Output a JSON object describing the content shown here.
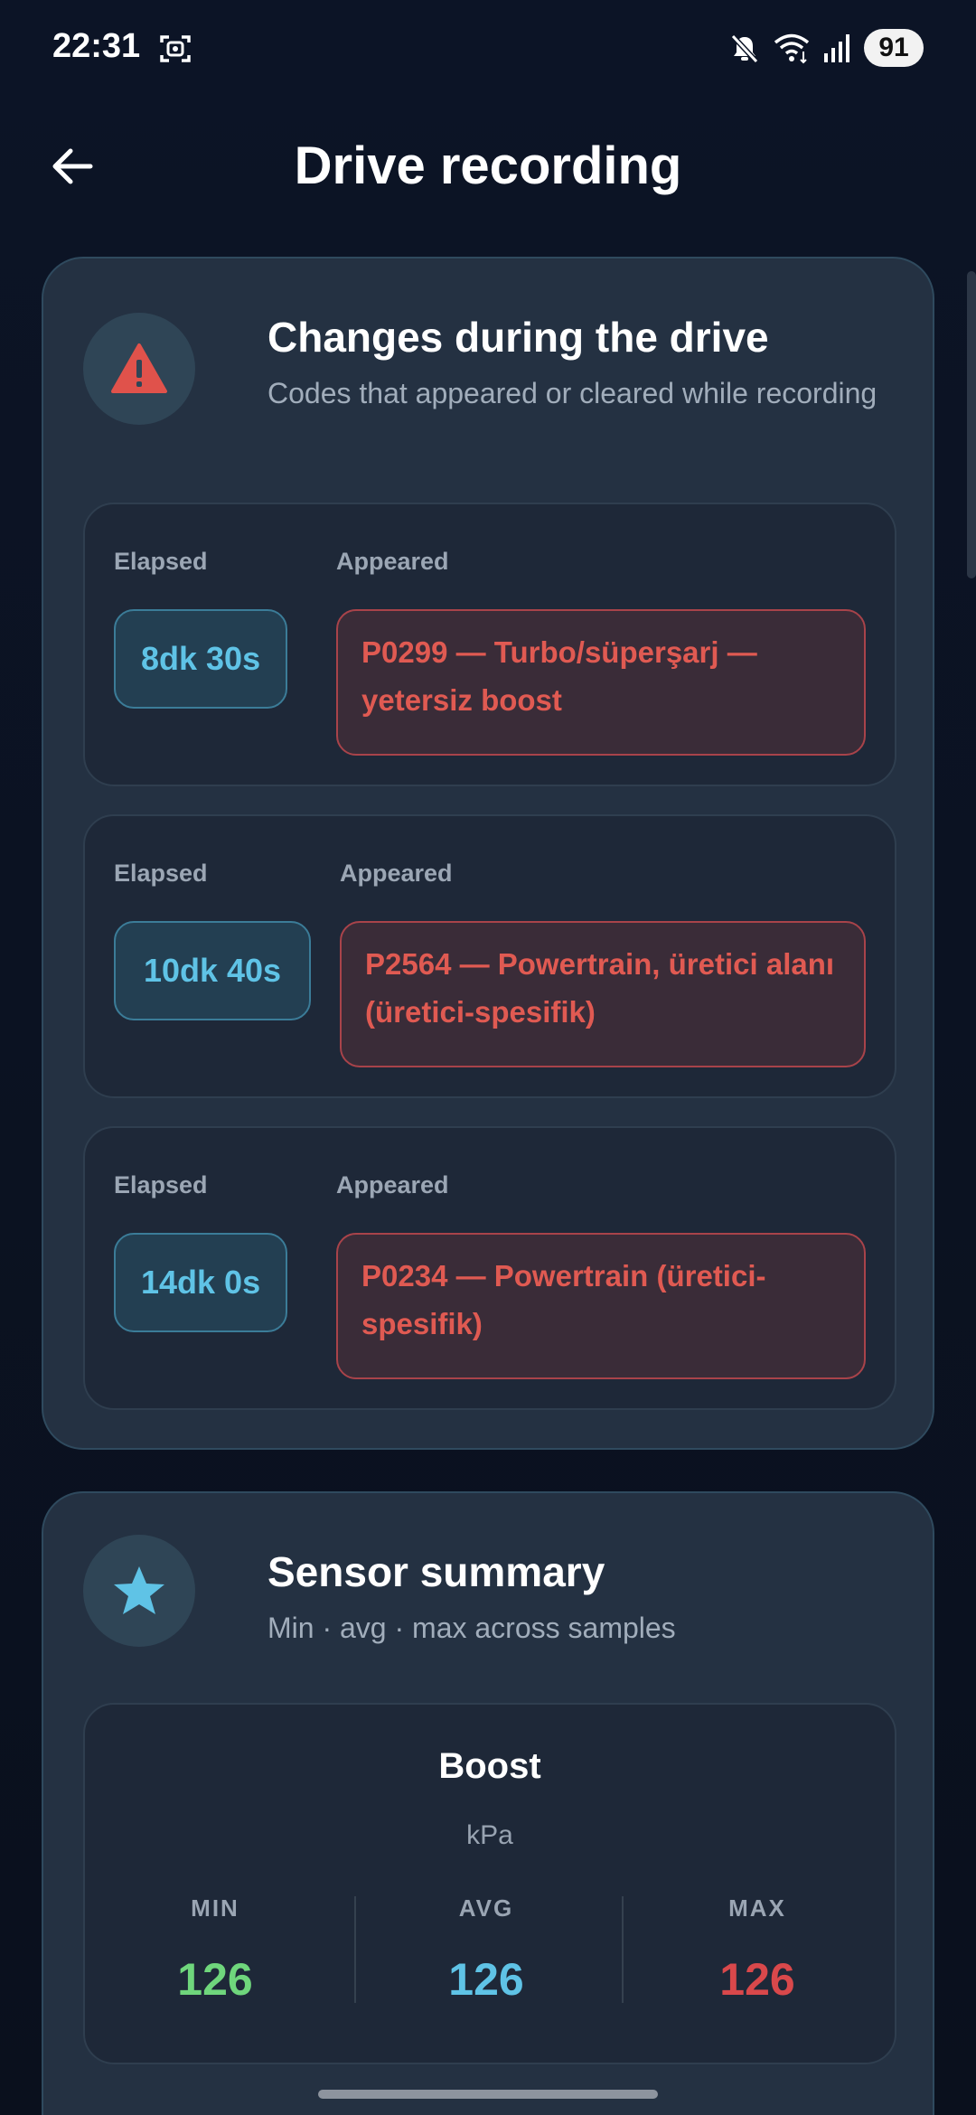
{
  "status_bar": {
    "time": "22:31",
    "battery": "91",
    "icons": [
      "screen-record-icon",
      "mute-icon",
      "wifi-icon",
      "signal-icon"
    ]
  },
  "header": {
    "title": "Drive recording",
    "back_icon": "arrow-left-icon"
  },
  "changes_card": {
    "title": "Changes during the drive",
    "subtitle": "Codes that appeared or cleared while recording",
    "icon": "warning-triangle-icon",
    "events": [
      {
        "elapsed_label": "Elapsed",
        "elapsed": "8dk 30s",
        "status_label": "Appeared",
        "code": "P0299 — Turbo/süperşarj — yetersiz boost"
      },
      {
        "elapsed_label": "Elapsed",
        "elapsed": "10dk 40s",
        "status_label": "Appeared",
        "code": "P2564 — Powertrain, üretici alanı (üretici-spesifik)"
      },
      {
        "elapsed_label": "Elapsed",
        "elapsed": "14dk 0s",
        "status_label": "Appeared",
        "code": "P0234 — Powertrain (üretici-spesifik)"
      }
    ]
  },
  "sensor_card": {
    "title": "Sensor summary",
    "subtitle": "Min · avg · max across samples",
    "icon": "star-icon",
    "sensor": {
      "name": "Boost",
      "unit": "kPa",
      "min_label": "MIN",
      "min": "126",
      "avg_label": "AVG",
      "avg": "126",
      "max_label": "MAX",
      "max": "126"
    }
  },
  "colors": {
    "background": "#0b1120",
    "card": "#243142",
    "accent_cyan": "#5fc3e6",
    "error_red": "#e05a52",
    "min_green": "#6fd67c",
    "max_red": "#d9484b"
  }
}
